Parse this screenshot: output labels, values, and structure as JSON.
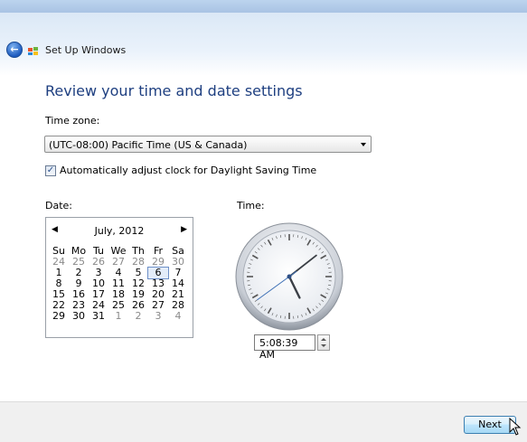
{
  "window": {
    "title": "Set Up Windows"
  },
  "page": {
    "heading": "Review your time and date settings"
  },
  "timezone": {
    "label": "Time zone:",
    "selected": "(UTC-08:00) Pacific Time (US & Canada)"
  },
  "dst": {
    "checked": true,
    "label": "Automatically adjust clock for Daylight Saving Time"
  },
  "date": {
    "label": "Date:",
    "month_title": "July, 2012",
    "weekday_headers": [
      "Su",
      "Mo",
      "Tu",
      "We",
      "Th",
      "Fr",
      "Sa"
    ],
    "days": [
      [
        "24",
        "25",
        "26",
        "27",
        "28",
        "29",
        "30"
      ],
      [
        "1",
        "2",
        "3",
        "4",
        "5",
        "6",
        "7"
      ],
      [
        "8",
        "9",
        "10",
        "11",
        "12",
        "13",
        "14"
      ],
      [
        "15",
        "16",
        "17",
        "18",
        "19",
        "20",
        "21"
      ],
      [
        "22",
        "23",
        "24",
        "25",
        "26",
        "27",
        "28"
      ],
      [
        "29",
        "30",
        "31",
        "1",
        "2",
        "3",
        "4"
      ]
    ],
    "selected_day": "6"
  },
  "time": {
    "label": "Time:",
    "value": "5:08:39 AM",
    "hour": 5,
    "minute": 8,
    "second": 39
  },
  "footer": {
    "next_label": "Next"
  },
  "colors": {
    "heading": "#1e3f80",
    "accent": "#3c7fb1"
  }
}
